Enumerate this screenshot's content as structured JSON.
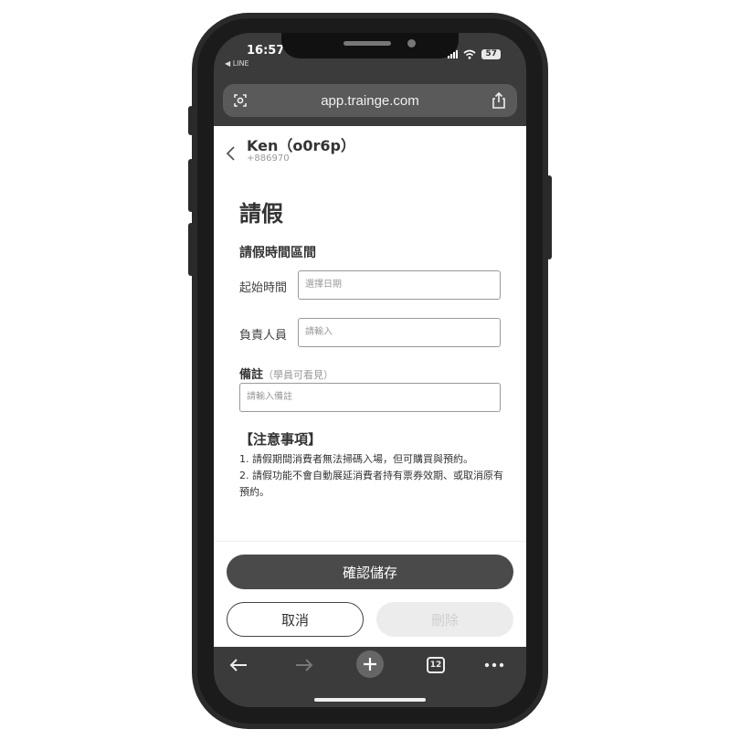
{
  "status_bar": {
    "time": "16:57",
    "back_app": "◀ LINE",
    "battery": "57"
  },
  "browser": {
    "url": "app.trainge.com",
    "tab_count": "12"
  },
  "header": {
    "name": "Ken（o0r6p）",
    "phone": "+886970"
  },
  "form": {
    "title": "請假",
    "section_title": "請假時間區間",
    "start_time_label": "起始時間",
    "start_time_placeholder": "選擇日期",
    "staff_label": "負責人員",
    "staff_placeholder": "請輸入",
    "note_label": "備註",
    "note_hint": "（學員可看見）",
    "note_placeholder": "請輸入備註"
  },
  "notice": {
    "title": "【注意事項】",
    "lines": [
      "1. 請假期間消費者無法掃碼入場，但可購買與預約。",
      "2. 請假功能不會自動展延消費者持有票券效期、或取消原有預約。"
    ]
  },
  "buttons": {
    "confirm": "確認儲存",
    "cancel": "取消",
    "delete": "刪除"
  },
  "colors": {
    "primary_button": "#4a4a4a",
    "browser_chrome": "#3b3b3b",
    "disabled_button": "#ececec"
  }
}
